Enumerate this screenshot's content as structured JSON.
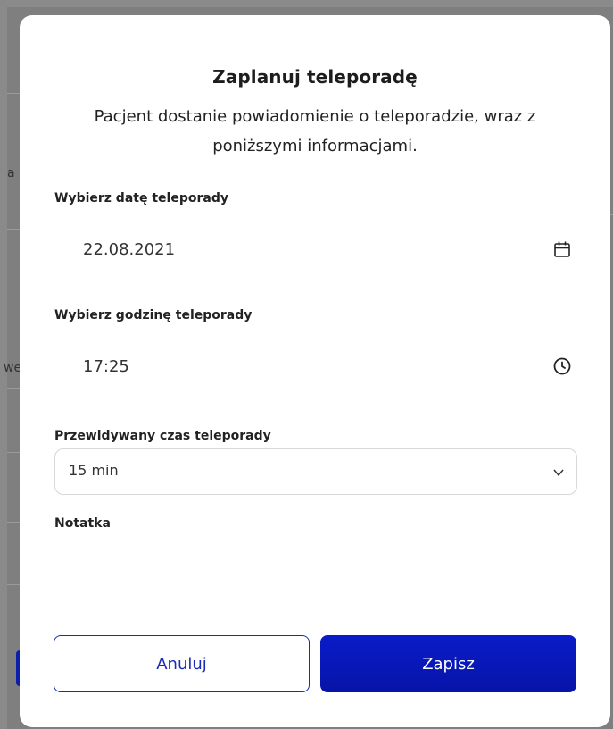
{
  "background": {
    "fragments": [
      "a",
      "we"
    ]
  },
  "dialog": {
    "title": "Zaplanuj teleporadę",
    "subtitle_line1": "Pacjent dostanie powiadomienie o teleporadzie, wraz z",
    "subtitle_line2": "poniższymi informacjami."
  },
  "date_field": {
    "label": "Wybierz datę teleporady",
    "value": "22.08.2021",
    "icon": "calendar-icon"
  },
  "time_field": {
    "label": "Wybierz godzinę teleporady",
    "value": "17:25",
    "icon": "clock-icon"
  },
  "duration_field": {
    "label": "Przewidywany czas teleporady",
    "value": "15 min",
    "icon": "chevron-down-icon"
  },
  "note_field": {
    "label": "Notatka"
  },
  "actions": {
    "cancel_label": "Anuluj",
    "save_label": "Zapisz"
  },
  "colors": {
    "primary": "#0a1cc9",
    "overlay": "#7f7f7f"
  }
}
